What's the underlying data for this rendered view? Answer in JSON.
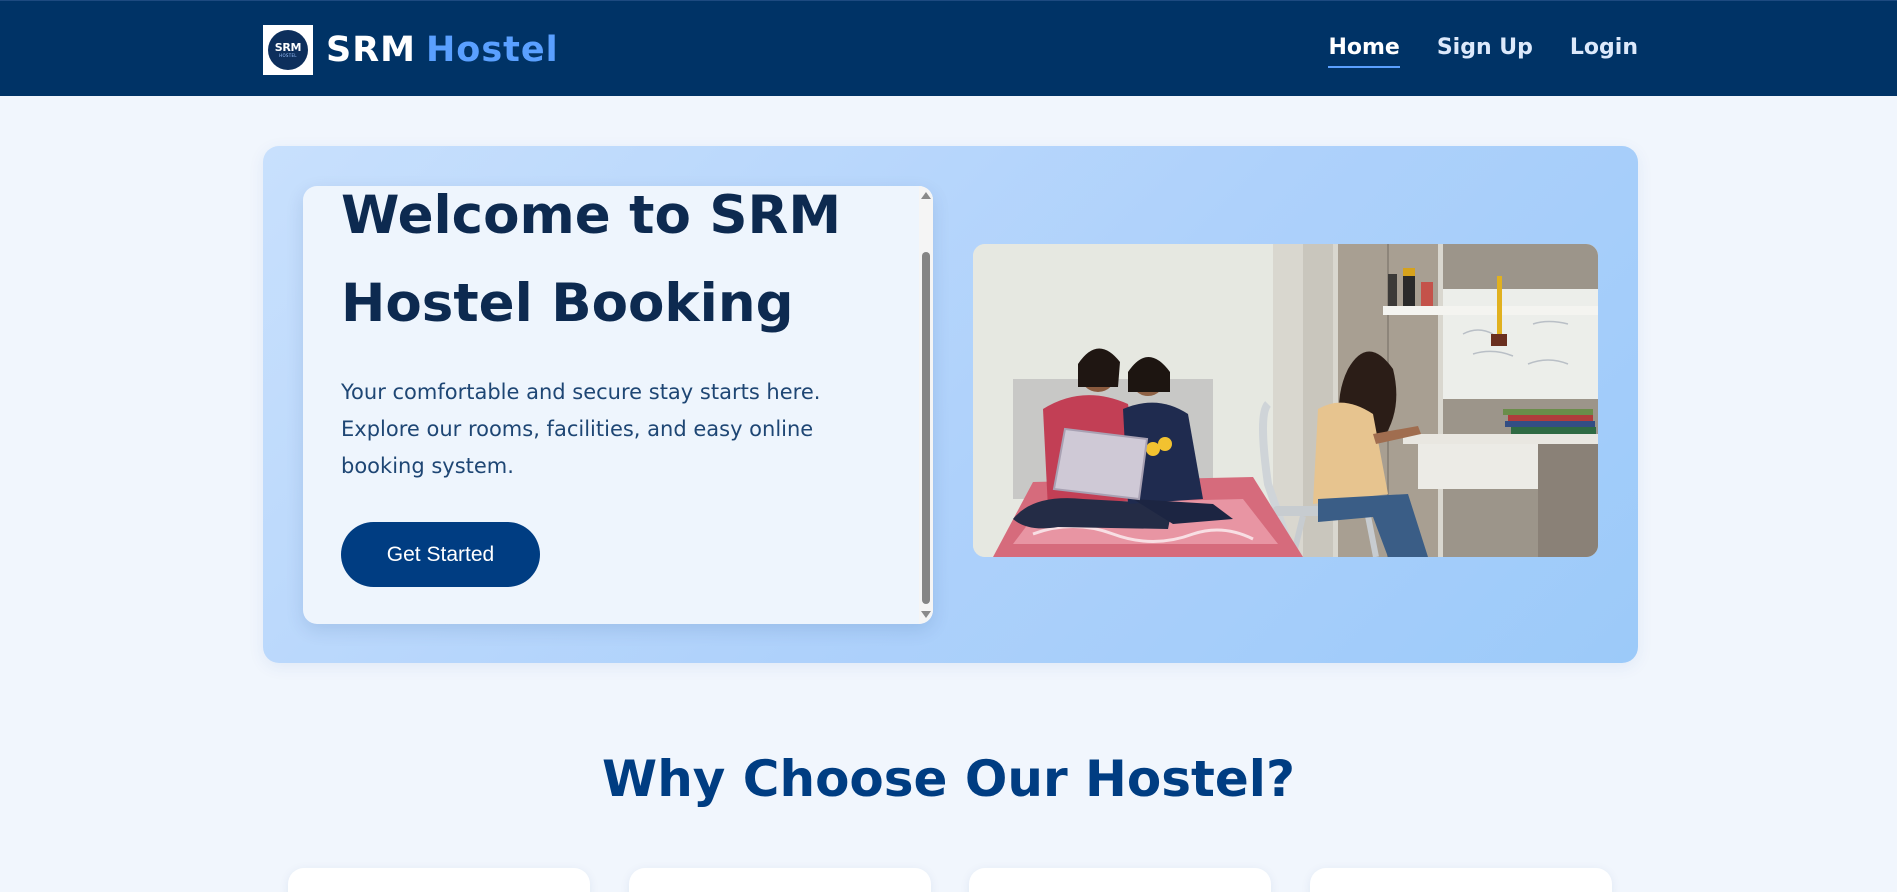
{
  "brand": {
    "logo_line1": "SRM",
    "logo_line2": "HOSTEL",
    "name_part1": "SRM",
    "name_part2": "Hostel"
  },
  "nav": {
    "items": [
      {
        "label": "Home",
        "active": true
      },
      {
        "label": "Sign Up",
        "active": false
      },
      {
        "label": "Login",
        "active": false
      }
    ]
  },
  "hero": {
    "title_line1": "Welcome to SRM",
    "title_line2": "Hostel Booking",
    "description": "Your comfortable and secure stay starts here. Explore our rooms, facilities, and easy online booking system.",
    "cta_label": "Get Started"
  },
  "features": {
    "title": "Why Choose Our Hostel?"
  },
  "colors": {
    "nav_bg": "#003366",
    "brand_accent": "#5aa0ff",
    "primary_button": "#003d82",
    "heading": "#0d2a50"
  }
}
